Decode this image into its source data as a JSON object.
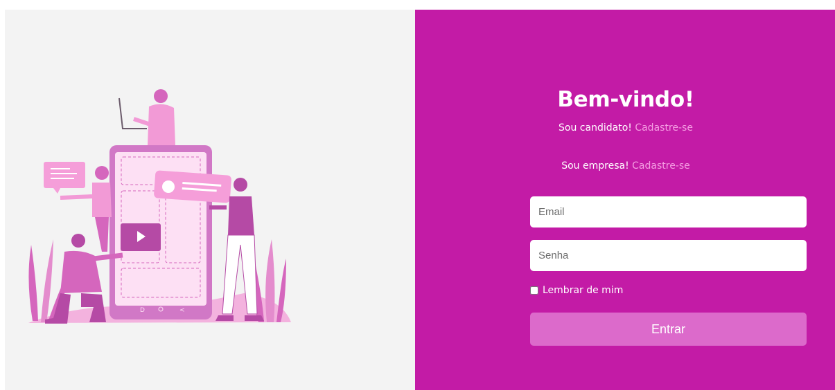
{
  "welcome": {
    "title": "Bem-vindo!",
    "candidate_text": "Sou candidato! ",
    "candidate_link": "Cadastre-se",
    "company_text": "Sou empresa! ",
    "company_link": "Cadastre-se"
  },
  "form": {
    "email_placeholder": "Email",
    "password_placeholder": "Senha",
    "remember_label": "Lembrar de mim",
    "submit_label": "Entrar"
  },
  "colors": {
    "panel_bg": "#c31ba6",
    "link": "#f59ee3",
    "button_bg": "#dc6acb",
    "left_bg": "#f3f3f3"
  },
  "illustration": {
    "icon": "people-with-phone-illustration",
    "video_icon": "play-icon"
  }
}
